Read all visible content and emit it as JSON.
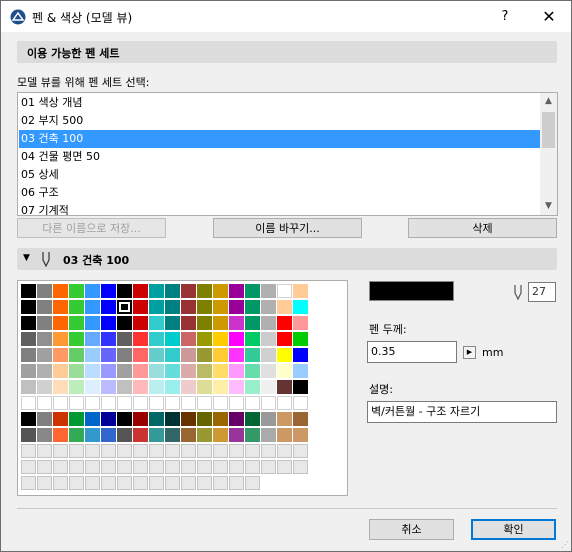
{
  "window": {
    "title": "펜 & 색상 (모델 뷰)",
    "help_label": "?",
    "close_label": "✕"
  },
  "available_sets": {
    "header": "이용 가능한 펜 세트",
    "select_label": "모델 뷰를 위해 펜 세트 선택:",
    "items": [
      "01 색상 개념",
      "02 부지 500",
      "03 건축 100",
      "04 건물 평면 50",
      "05 상세",
      "06 구조",
      "07 기계적"
    ],
    "selected_index": 2,
    "buttons": {
      "save_as": "다른 이름으로 저장...",
      "rename": "이름 바꾸기...",
      "delete": "삭제"
    }
  },
  "pen_set_panel": {
    "header": "03 건축 100",
    "pen_number": "27"
  },
  "pen": {
    "thickness_label": "펜 두께:",
    "thickness_value": "0.35",
    "unit": "mm",
    "description_label": "설명:",
    "description_value": "벽/커튼월 - 구조 자르기",
    "swatch_color": "#000000"
  },
  "palette_rows": [
    [
      "#000000",
      "#808080",
      "#ff6600",
      "#33cc33",
      "#3399ff",
      "#0000ff",
      "#000000",
      "#cc0000",
      "#00a0a0",
      "#008080",
      "#993333",
      "#808000",
      "#cc9900",
      "#990099",
      "#009966",
      "#b0b0b0",
      "#ffffff",
      "#ffcc99"
    ],
    [
      "#000000",
      "#808080",
      "#ff6600",
      "#33cc33",
      "#3399ff",
      "#0000ff",
      "#000000",
      "#cc0000",
      "#00a0a0",
      "#008080",
      "#993333",
      "#808000",
      "#cc9900",
      "#990099",
      "#009966",
      "#b0b0b0",
      "#ffcc99",
      "#00ffff"
    ],
    [
      "#000000",
      "#808080",
      "#ff6600",
      "#33cc33",
      "#3399ff",
      "#0000ff",
      "#000000",
      "#cc0000",
      "#33cccc",
      "#008080",
      "#993333",
      "#808000",
      "#cc9900",
      "#cc33cc",
      "#009966",
      "#b0b0b0",
      "#ff0000",
      "#ff9999"
    ],
    [
      "#606060",
      "#909090",
      "#ff9933",
      "#33cc33",
      "#66aaff",
      "#3333ff",
      "#606060",
      "#ff3333",
      "#33cccc",
      "#00cccc",
      "#cc6666",
      "#999900",
      "#ffcc00",
      "#ff00ff",
      "#00cc66",
      "#cccccc",
      "#ff0000",
      "#00cc00"
    ],
    [
      "#808080",
      "#a0a0a0",
      "#ff9966",
      "#66cc66",
      "#99ccff",
      "#6666ff",
      "#808080",
      "#ff6666",
      "#66cccc",
      "#33cccc",
      "#cc9999",
      "#999933",
      "#ffcc33",
      "#ff33ff",
      "#33cc99",
      "#d0d0d0",
      "#ffff00",
      "#0000ff"
    ],
    [
      "#a0a0a0",
      "#b0b0b0",
      "#ffcc99",
      "#99dd99",
      "#bbddff",
      "#9999ff",
      "#a0a0a0",
      "#ff9999",
      "#99dddd",
      "#66dddd",
      "#ddaaaa",
      "#bbbb66",
      "#ffdd66",
      "#ff99ff",
      "#66ddaa",
      "#e0e0e0",
      "#ffffcc",
      "#99ccff"
    ],
    [
      "#c0c0c0",
      "#d0d0d0",
      "#ffddbb",
      "#bbeebb",
      "#ddeeff",
      "#bbbbff",
      "#c0c0c0",
      "#ffbbbb",
      "#bbeeee",
      "#99eeee",
      "#eecccc",
      "#dddd99",
      "#ffeeaa",
      "#ffbbff",
      "#99eecc",
      "#f0f0f0",
      "#663333",
      "#000000"
    ],
    [
      "#ffffff",
      "#ffffff",
      "#ffffff",
      "#ffffff",
      "#ffffff",
      "#ffffff",
      "#ffffff",
      "#ffffff",
      "#ffffff",
      "#ffffff",
      "#ffffff",
      "#ffffff",
      "#ffffff",
      "#ffffff",
      "#ffffff",
      "#ffffff",
      "#ffffff",
      "#ffffff"
    ],
    [
      "#000000",
      "#808080",
      "#cc3300",
      "#009933",
      "#0066cc",
      "#000099",
      "#000000",
      "#990000",
      "#006666",
      "#003333",
      "#663300",
      "#666600",
      "#996600",
      "#660066",
      "#006633",
      "#999999",
      "#cc9966",
      "#996633"
    ],
    [
      "#555555",
      "#888888",
      "#ff6633",
      "#33aa55",
      "#3399cc",
      "#3366cc",
      "#555555",
      "#cc3333",
      "#339999",
      "#336666",
      "#996633",
      "#999933",
      "#cc9933",
      "#993399",
      "#339966",
      "#aaaaaa",
      "#cc9966",
      "#cc9966"
    ]
  ],
  "footer": {
    "cancel": "취소",
    "ok": "확인"
  }
}
